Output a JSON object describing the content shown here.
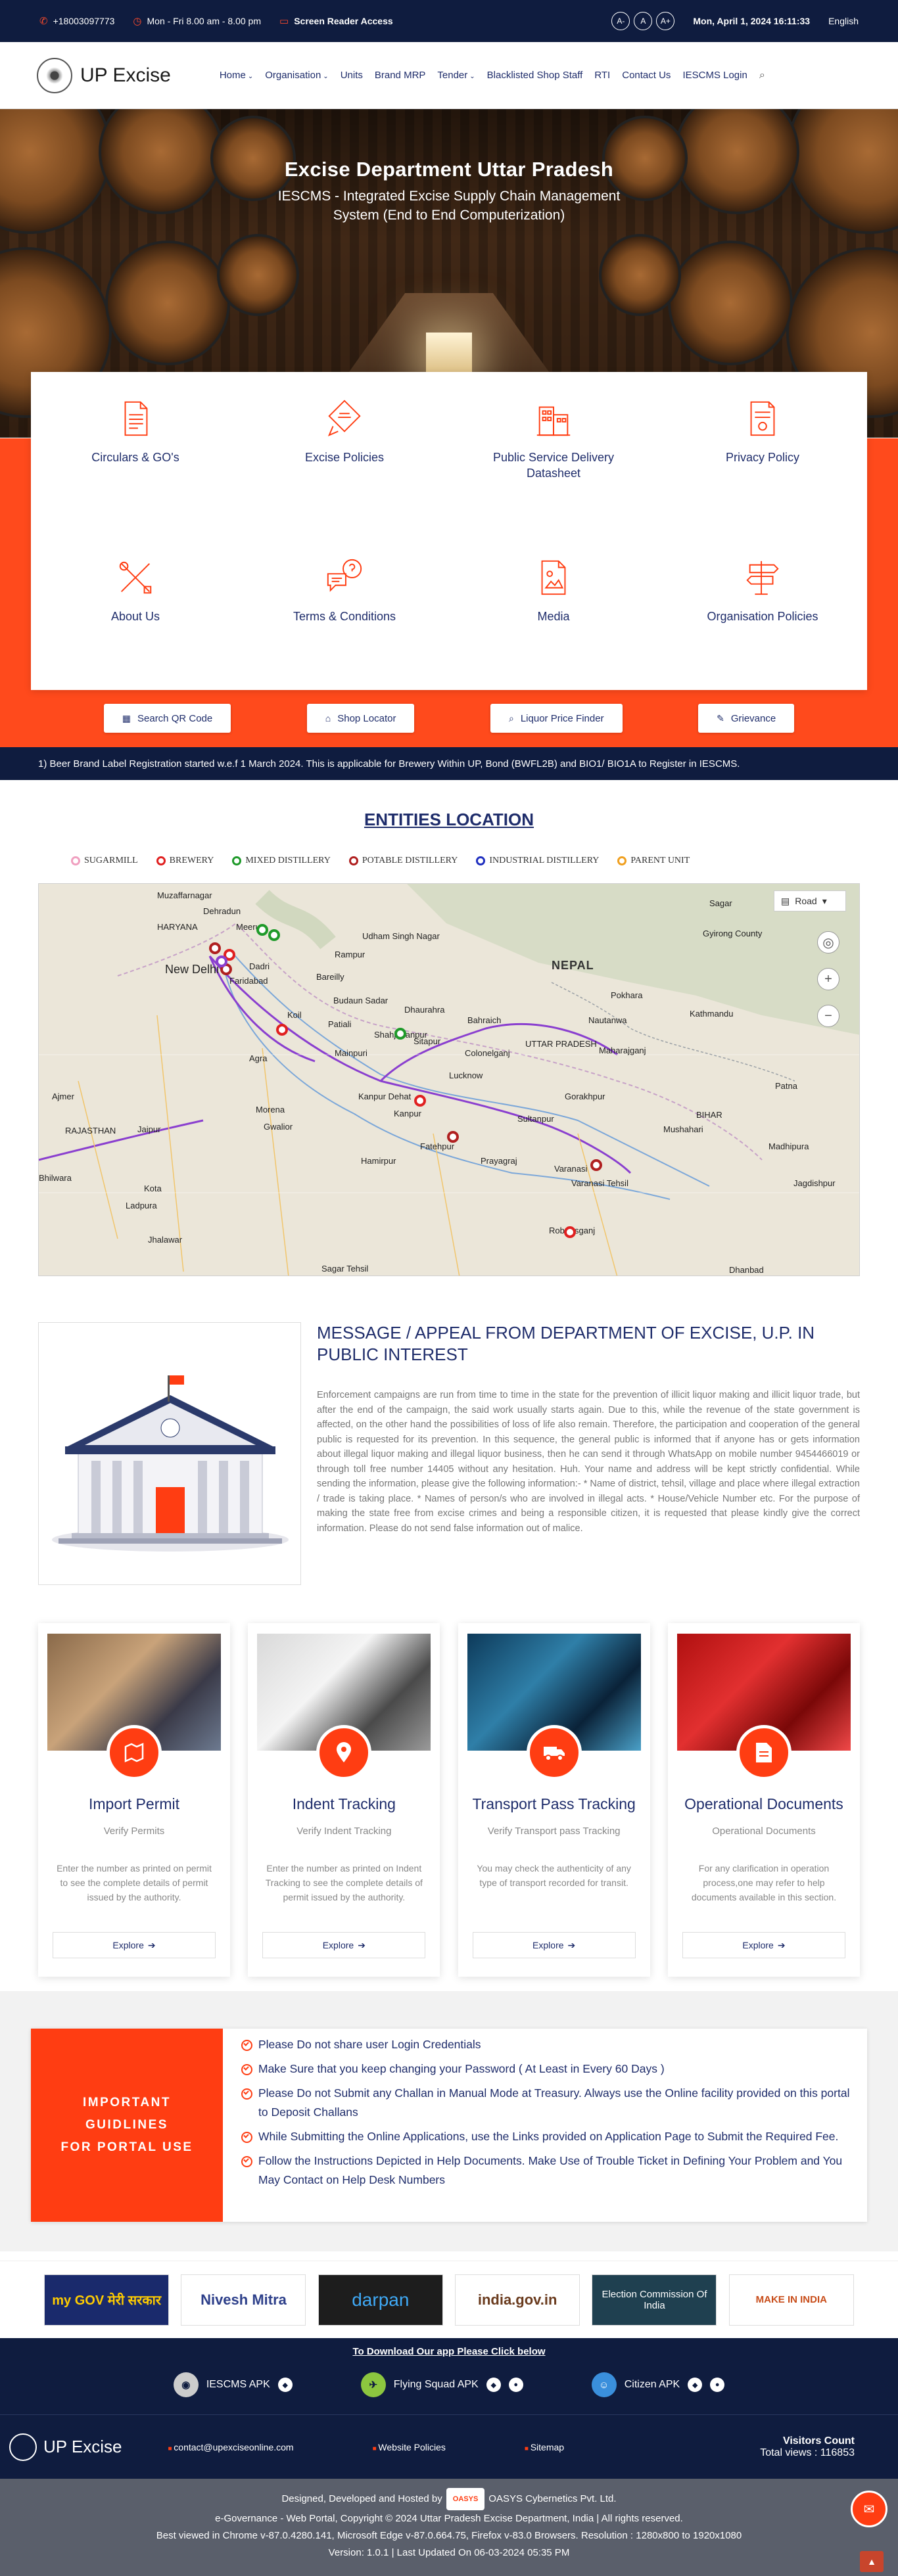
{
  "topbar": {
    "phone": "+18003097773",
    "hours": "Mon - Fri 8.00 am - 8.00 pm",
    "screen_reader": "Screen Reader Access",
    "font_minus": "A-",
    "font_normal": "A",
    "font_plus": "A+",
    "datetime": "Mon, April 1, 2024 16:11:33",
    "language": "English"
  },
  "header": {
    "brand": "UP Excise",
    "nav": [
      "Home",
      "Organisation",
      "Units",
      "Brand MRP",
      "Tender",
      "Blacklisted Shop Staff",
      "RTI",
      "Contact Us",
      "IESCMS Login"
    ]
  },
  "hero": {
    "title": "Excise Department Uttar Pradesh",
    "subtitle": "IESCMS - Integrated Excise Supply Chain Management System (End to End Computerization)"
  },
  "tiles": [
    {
      "label": "Circulars & GO's",
      "icon": "document-icon"
    },
    {
      "label": "Excise Policies",
      "icon": "policy-icon"
    },
    {
      "label": "Public Service Delivery Datasheet",
      "icon": "building-icon"
    },
    {
      "label": "Privacy Policy",
      "icon": "privacy-document-icon"
    },
    {
      "label": "About Us",
      "icon": "tools-icon"
    },
    {
      "label": "Terms & Conditions",
      "icon": "chat-question-icon"
    },
    {
      "label": "Media",
      "icon": "media-file-icon"
    },
    {
      "label": "Organisation Policies",
      "icon": "signpost-icon"
    }
  ],
  "quick_buttons": [
    "Search QR Code",
    "Shop Locator",
    "Liquor Price Finder",
    "Grievance"
  ],
  "ticker": "1) Beer Brand Label Registration started w.e.f 1 March 2024. This is applicable for Brewery Within UP, Bond (BWFL2B) and BIO1/ BIO1A to Register in IESCMS.",
  "entities": {
    "title": "ENTITIES LOCATION",
    "legend": [
      {
        "label": "SUGARMILL",
        "color": "#f0a0c0"
      },
      {
        "label": "BREWERY",
        "color": "#e02020"
      },
      {
        "label": "MIXED DISTILLERY",
        "color": "#1f9a2a"
      },
      {
        "label": "POTABLE DISTILLERY",
        "color": "#b02020"
      },
      {
        "label": "INDUSTRIAL DISTILLERY",
        "color": "#2030c0"
      },
      {
        "label": "PARENT UNIT",
        "color": "#f0a020"
      }
    ],
    "map_type": "Road",
    "places": [
      "Muzaffarnagar",
      "Dehradun",
      "Meerut",
      "Udham Singh Nagar",
      "Rampur",
      "NEPAL",
      "Sagar",
      "Gyirong County",
      "Pokhara",
      "Kathmandu",
      "New Delhi",
      "Dadri",
      "Faridabad",
      "Bareilly",
      "Budaun Sadar",
      "Dhaurahra",
      "Bahraich",
      "Nautanwa",
      "Maharajganj",
      "Koil",
      "Patiali",
      "Shahjahanpur",
      "Sitapur",
      "UTTAR PRADESH",
      "Mainpuri",
      "Colonelganj",
      "Agra",
      "Lucknow",
      "Gorakhpur",
      "Kanpur Dehat",
      "Ajmer",
      "Morena",
      "Kanpur",
      "Sultanpur",
      "Gwalior",
      "Mushahari",
      "BIHAR",
      "Jaipur",
      "RAJASTHAN",
      "Fatehpur",
      "Madhipura",
      "Hamirpur",
      "Prayagraj",
      "Varanasi",
      "Varanasi Tehsil",
      "Jagdishpur",
      "Bhilwara",
      "Kota",
      "Ladpura",
      "Robertsganj",
      "Jhalawar",
      "Sagar Tehsil",
      "Dhanbad",
      "HARYANA",
      "Patna"
    ]
  },
  "message": {
    "title": "MESSAGE / APPEAL FROM DEPARTMENT OF EXCISE, U.P. IN PUBLIC INTEREST",
    "body": "Enforcement campaigns are run from time to time in the state for the prevention of illicit liquor making and illicit liquor trade, but after the end of the campaign, the said work usually starts again. Due to this, while the revenue of the state government is affected, on the other hand the possibilities of loss of life also remain. Therefore, the participation and cooperation of the general public is requested for its prevention. In this sequence, the general public is informed that if anyone has or gets information about illegal liquor making and illegal liquor business, then he can send it through WhatsApp on mobile number 9454466019 or through toll free number 14405 without any hesitation. Huh. Your name and address will be kept strictly confidential. While sending the information, please give the following information:- * Name of district, tehsil, village and place where illegal extraction / trade is taking place. * Names of person/s who are involved in illegal acts. * House/Vehicle Number etc. For the purpose of making the state free from excise crimes and being a responsible citizen, it is requested that please kindly give the correct information. Please do not send false information out of malice."
  },
  "cards": [
    {
      "title": "Import Permit",
      "subtitle": "Verify Permits",
      "text": "Enter the number as printed on permit to see the complete details of permit issued by the authority.",
      "button": "Explore",
      "icon": "map-icon"
    },
    {
      "title": "Indent Tracking",
      "subtitle": "Verify Indent Tracking",
      "text": "Enter the number as printed on Indent Tracking to see the complete details of permit issued by the authority.",
      "button": "Explore",
      "icon": "location-pin-icon"
    },
    {
      "title": "Transport Pass Tracking",
      "subtitle": "Verify Transport pass Tracking",
      "text": "You may check the authenticity of any type of transport recorded for transit.",
      "button": "Explore",
      "icon": "truck-icon"
    },
    {
      "title": "Operational Documents",
      "subtitle": "Operational Documents",
      "text": "For any clarification in operation process,one may refer to help documents available in this section.",
      "button": "Explore",
      "icon": "file-icon"
    }
  ],
  "guidelines": {
    "label_lines": [
      "IMPORTANT",
      "GUIDLINES",
      "FOR PORTAL USE"
    ],
    "items": [
      "Please Do not share user Login Credentials",
      "Make Sure that you keep changing your Password ( At Least in Every 60 Days )",
      "Please Do not Submit any Challan in Manual Mode at Treasury. Always use the Online facility provided on this portal to Deposit Challans",
      "While Submitting the Online Applications, use the Links provided on Application Page to Submit the Required Fee.",
      "Follow the Instructions Depicted in Help Documents. Make Use of Trouble Ticket in Defining Your Problem and You May Contact on Help Desk Numbers"
    ]
  },
  "partner_logos": [
    {
      "name": "myGov",
      "text": "my GOV मेरी सरकार"
    },
    {
      "name": "nivesh-mitra",
      "text": "Nivesh Mitra"
    },
    {
      "name": "darpan",
      "text": "darpan"
    },
    {
      "name": "india-gov",
      "text": "india.gov.in"
    },
    {
      "name": "election-commission",
      "text": "Election Commission Of India"
    },
    {
      "name": "make-in-india",
      "text": "MAKE IN INDIA"
    }
  ],
  "apps": {
    "download_text": "To Download Our app Please Click below",
    "items": [
      "IESCMS APK",
      "Flying Squad APK",
      "Citizen APK"
    ]
  },
  "footer": {
    "brand": "UP Excise",
    "email": "contact@upexciseonline.com",
    "website_policies": "Website Policies",
    "sitemap": "Sitemap",
    "visitors_label": "Visitors Count",
    "visitors_total": "Total views : 116853",
    "designed_by_prefix": "Designed, Developed and Hosted by",
    "oasys_badge": "OASYS",
    "company": "OASYS Cybernetics Pvt. Ltd.",
    "copyright": "e-Governance - Web Portal, Copyright © 2024 Uttar Pradesh Excise Department, India | All rights reserved.",
    "browsers": "Best viewed in Chrome v-87.0.4280.141, Microsoft Edge v-87.0.664.75, Firefox v-83.0 Browsers. Resolution : 1280x800 to 1920x1080",
    "version": "Version: 1.0.1 | Last Updated On 06-03-2024 05:35 PM"
  },
  "colors": {
    "navy": "#0f1c3f",
    "accent": "#ff3d12",
    "heading": "#1f2d6b"
  }
}
